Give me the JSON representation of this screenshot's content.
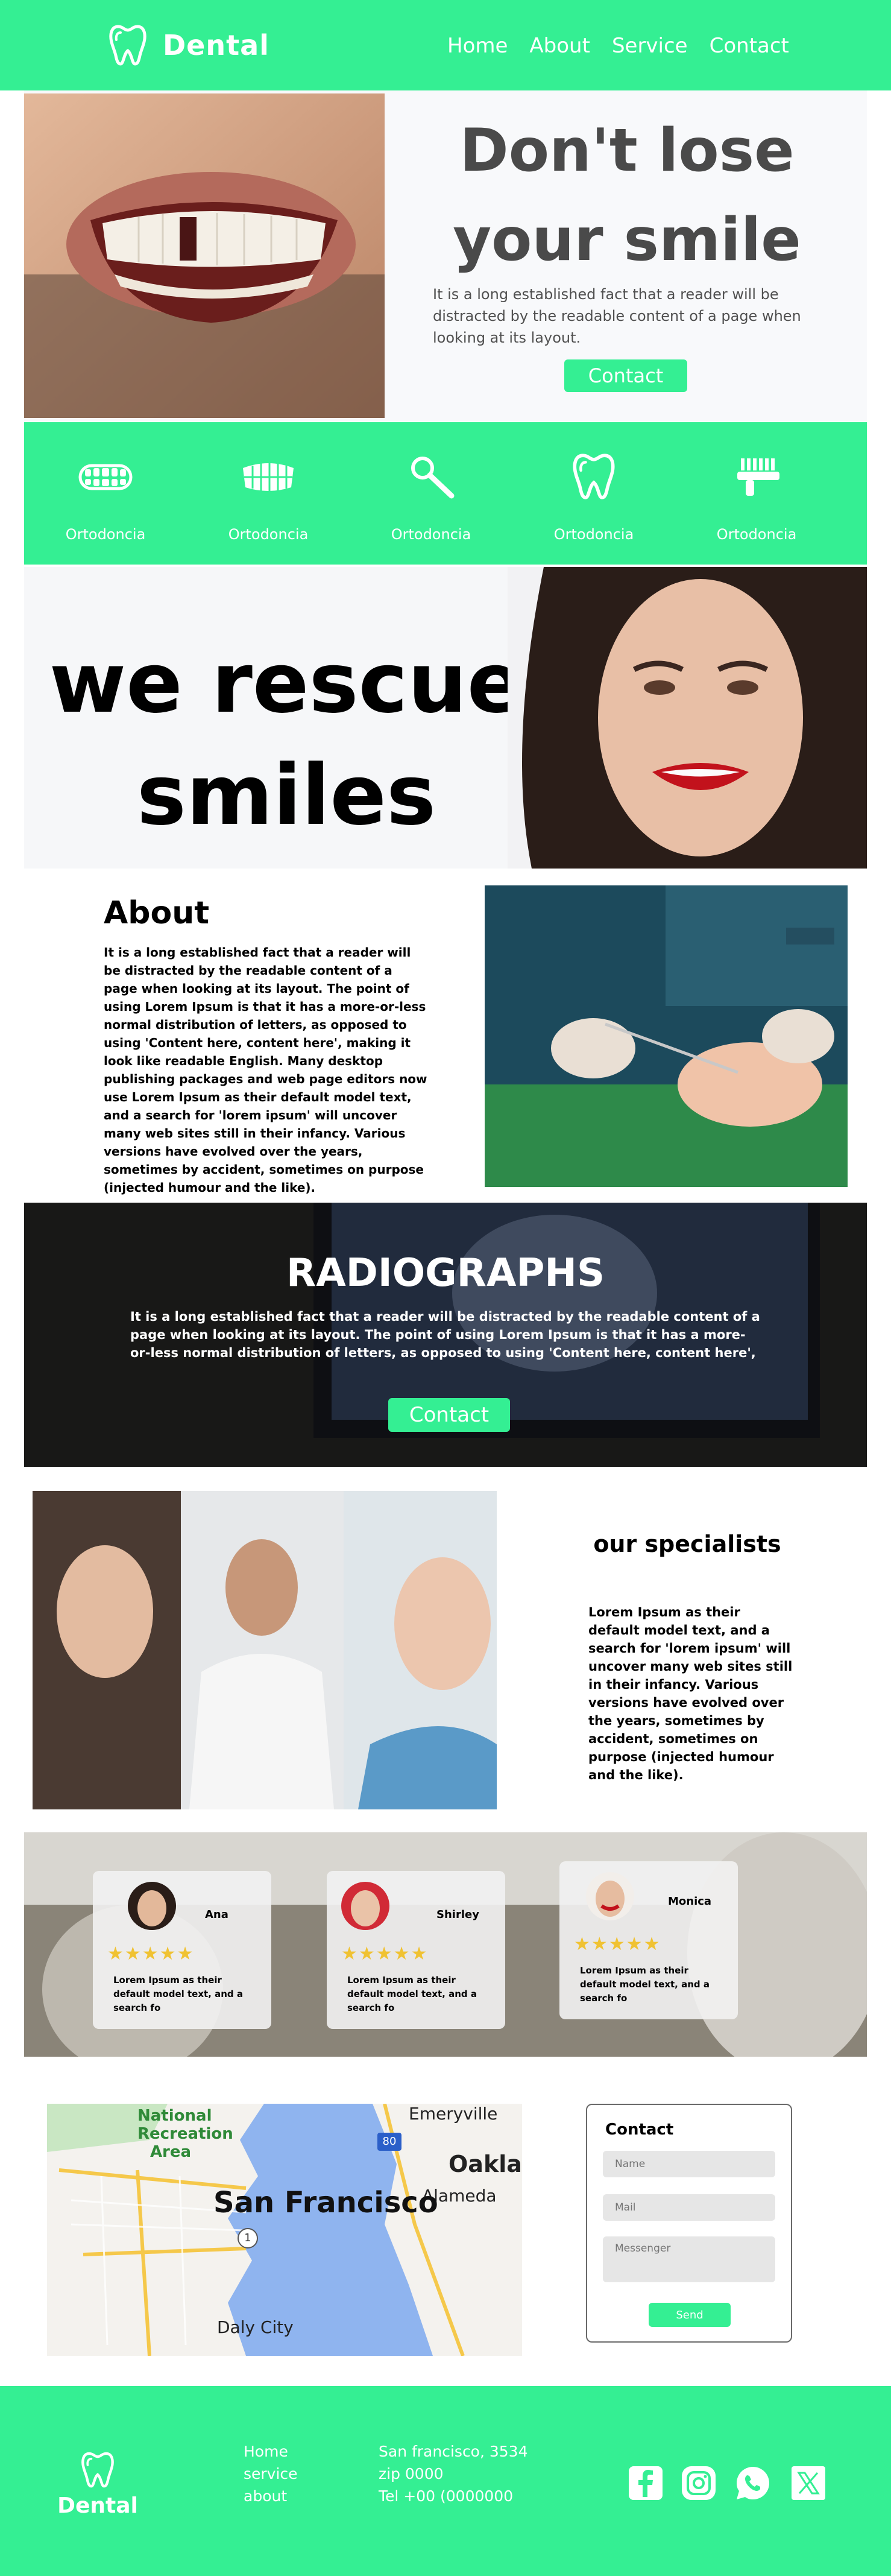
{
  "brand": {
    "name": "Dental",
    "accent": "#34ef93"
  },
  "nav": {
    "items": [
      "Home",
      "About",
      "Service",
      "Contact"
    ]
  },
  "hero": {
    "title": "Don't lose your smile",
    "text": "It is a long established fact that a reader will be distracted by the readable content of a page when looking at its layout.",
    "button": "Contact"
  },
  "services": {
    "items": [
      {
        "label": "Ortodoncia",
        "icon": "denture-icon"
      },
      {
        "label": "Ortodoncia",
        "icon": "braces-icon"
      },
      {
        "label": "Ortodoncia",
        "icon": "dental-mirror-icon"
      },
      {
        "label": "Ortodoncia",
        "icon": "tooth-icon"
      },
      {
        "label": "Ortodoncia",
        "icon": "toothbrush-icon"
      }
    ]
  },
  "rescue": {
    "title": "we rescue smiles"
  },
  "about": {
    "title": "About",
    "text": "It is a long established fact that a reader will be distracted by the readable content of a page when looking at its layout. The point of using Lorem Ipsum is that it has a more-or-less normal distribution of letters, as opposed to using 'Content here, content here', making it look like readable English. Many desktop publishing packages and web page editors now use Lorem Ipsum as their default model text, and a search for 'lorem ipsum' will uncover many web sites still in their infancy. Various versions have evolved over the years, sometimes by accident, sometimes on purpose (injected humour and the like)."
  },
  "radiographs": {
    "title": "RADIOGRAPHS",
    "text": "It is a long established fact that a reader will be distracted by the readable content of a page when looking at its layout. The point of using Lorem Ipsum is that it has a more-or-less normal distribution of letters, as opposed to using 'Content here, content here',",
    "button": "Contact"
  },
  "specialists": {
    "title": "our specialists",
    "text": "Lorem Ipsum as their default model text, and a search for 'lorem ipsum' will uncover many web sites still in their infancy. Various versions have evolved over the years, sometimes by accident, sometimes on purpose (injected humour and the like)."
  },
  "testimonials": [
    {
      "name": "Ana",
      "stars": 5,
      "text": "Lorem Ipsum as their default model text, and a search fo"
    },
    {
      "name": "Shirley",
      "stars": 5,
      "text": "Lorem Ipsum as their default model text, and a search fo"
    },
    {
      "name": "Monica",
      "stars": 5,
      "text": "Lorem Ipsum as their default model text, and a search fo"
    }
  ],
  "map": {
    "labels": {
      "city": "San Francisco",
      "oakland": "Oakland",
      "emeryville": "Emeryville",
      "alameda": "Alameda",
      "daly": "Daly City",
      "recreation": "National Recreation Area",
      "shield80": "80",
      "shield1": "1"
    }
  },
  "contact": {
    "title": "Contact",
    "name_placeholder": "Name",
    "mail_placeholder": "Mail",
    "message_placeholder": "Messenger",
    "send": "Send"
  },
  "footer": {
    "links": [
      "Home",
      "service",
      "about"
    ],
    "address": "San francisco, 3534",
    "zip": "zip  0000",
    "tel": "Tel  +00 (0000000"
  },
  "social": [
    "facebook-icon",
    "instagram-icon",
    "whatsapp-icon",
    "x-icon"
  ]
}
